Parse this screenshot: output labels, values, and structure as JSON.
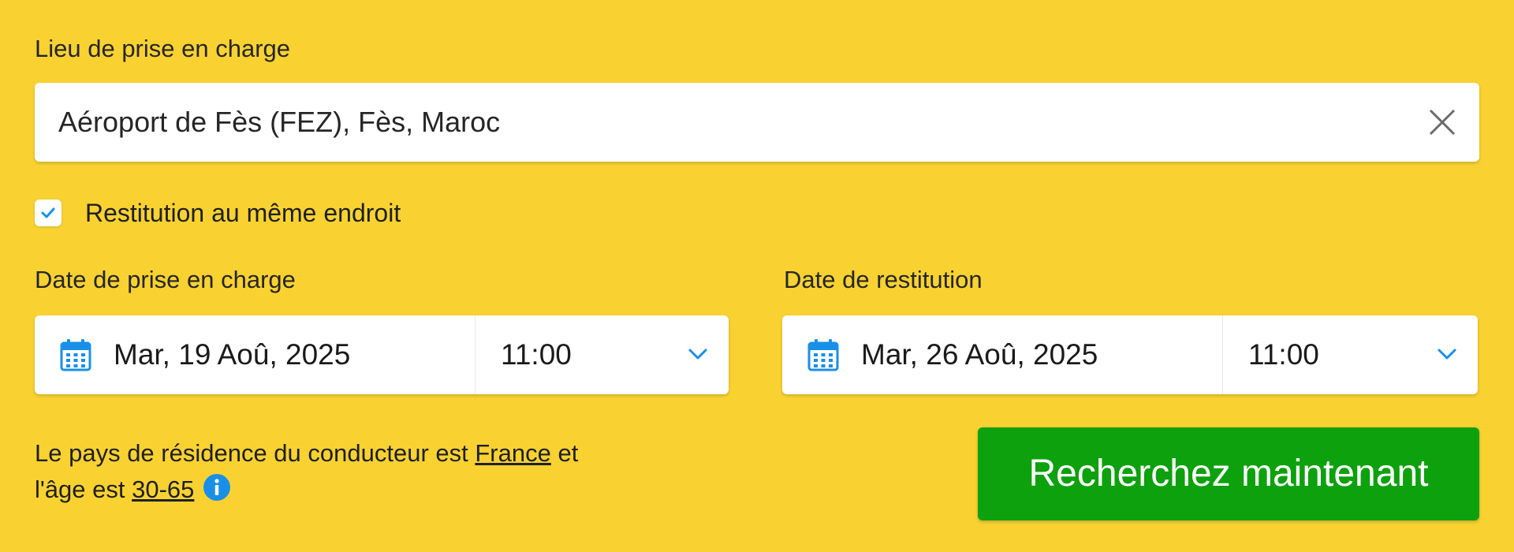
{
  "pickup_location": {
    "label": "Lieu de prise en charge",
    "value": "Aéroport de Fès (FEZ), Fès, Maroc",
    "clear_icon": "close-icon"
  },
  "same_location": {
    "checked": true,
    "label": "Restitution au même endroit"
  },
  "pickup_date": {
    "label": "Date de prise en charge",
    "date": "Mar, 19 Aoû, 2025",
    "time": "11:00",
    "icon": "calendar-icon"
  },
  "return_date": {
    "label": "Date de restitution",
    "date": "Mar, 26 Aoû, 2025",
    "time": "11:00",
    "icon": "calendar-icon"
  },
  "driver_info": {
    "text_before_country": "Le pays de résidence du conducteur est ",
    "country": "France",
    "text_after_country": " et",
    "text_before_age": "l'âge est ",
    "age": "30-65",
    "info_icon": "info-icon"
  },
  "search_button": {
    "label": "Recherchez maintenant"
  },
  "colors": {
    "background": "#F9D232",
    "button": "#0DA10D",
    "accent_blue": "#1A8FE8"
  }
}
